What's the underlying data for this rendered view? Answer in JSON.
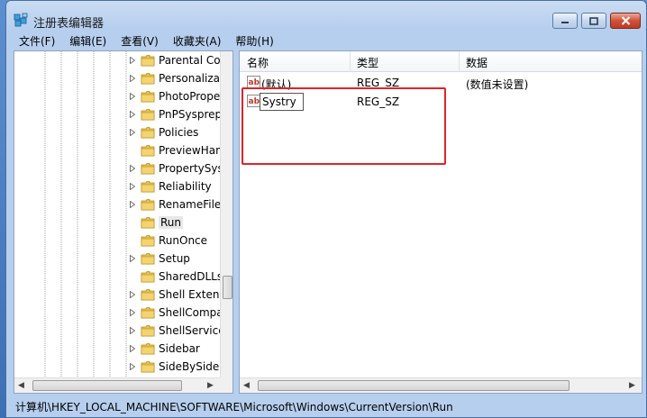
{
  "window": {
    "title": "注册表编辑器"
  },
  "menu": [
    "文件(F)",
    "编辑(E)",
    "查看(V)",
    "收藏夹(A)",
    "帮助(H)"
  ],
  "tree": {
    "items": [
      {
        "label": "Parental Co",
        "expandable": true
      },
      {
        "label": "Personaliza",
        "expandable": true
      },
      {
        "label": "PhotoPrope",
        "expandable": true
      },
      {
        "label": "PnPSysprep",
        "expandable": true
      },
      {
        "label": "Policies",
        "expandable": true
      },
      {
        "label": "PreviewHan",
        "expandable": false
      },
      {
        "label": "PropertySys",
        "expandable": true
      },
      {
        "label": "Reliability",
        "expandable": true
      },
      {
        "label": "RenameFile",
        "expandable": true
      },
      {
        "label": "Run",
        "expandable": false,
        "selected": true
      },
      {
        "label": "RunOnce",
        "expandable": false
      },
      {
        "label": "Setup",
        "expandable": true
      },
      {
        "label": "SharedDLLs",
        "expandable": false
      },
      {
        "label": "Shell Extens",
        "expandable": true
      },
      {
        "label": "ShellCompa",
        "expandable": true
      },
      {
        "label": "ShellService",
        "expandable": true
      },
      {
        "label": "Sidebar",
        "expandable": true
      },
      {
        "label": "SideBySide",
        "expandable": true
      }
    ]
  },
  "columns": {
    "name": "名称",
    "type": "类型",
    "data": "数据"
  },
  "values": [
    {
      "name": "(默认)",
      "type": "REG_SZ",
      "data": "(数值未设置)"
    },
    {
      "name": "Systry",
      "type": "REG_SZ",
      "data": "",
      "editing": true
    }
  ],
  "status": {
    "path": "计算机\\HKEY_LOCAL_MACHINE\\SOFTWARE\\Microsoft\\Windows\\CurrentVersion\\Run"
  },
  "colors": {
    "highlight": "#e0242a",
    "folder": "#e8c350"
  }
}
